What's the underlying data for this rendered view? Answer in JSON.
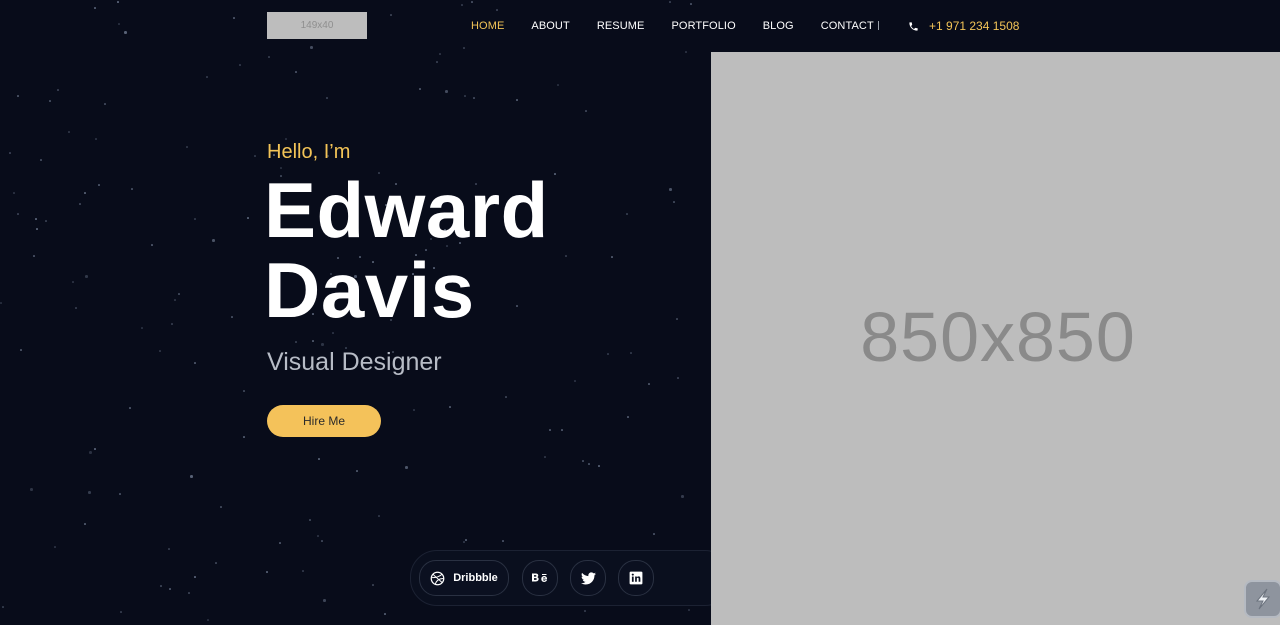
{
  "header": {
    "logo_text": "149x40",
    "nav": [
      {
        "label": "HOME",
        "active": true
      },
      {
        "label": "ABOUT",
        "active": false
      },
      {
        "label": "RESUME",
        "active": false
      },
      {
        "label": "PORTFOLIO",
        "active": false
      },
      {
        "label": "BLOG",
        "active": false
      },
      {
        "label": "CONTACT",
        "active": false
      }
    ],
    "separator": "|",
    "phone": "+1 971 234 1508",
    "phone_icon": "phone-icon"
  },
  "hero": {
    "greeting": "Hello, I’m",
    "first_name": "Edward",
    "last_name": "Davis",
    "role": "Visual Designer",
    "cta_label": "Hire Me",
    "image_placeholder": "850x850"
  },
  "social": {
    "dribbble_label": "Dribbble",
    "icons": [
      "dribbble-icon",
      "behance-icon",
      "twitter-icon",
      "linkedin-icon"
    ]
  },
  "colors": {
    "background": "#080c1a",
    "accent": "#f3c457",
    "placeholder": "#bdbdbd"
  }
}
